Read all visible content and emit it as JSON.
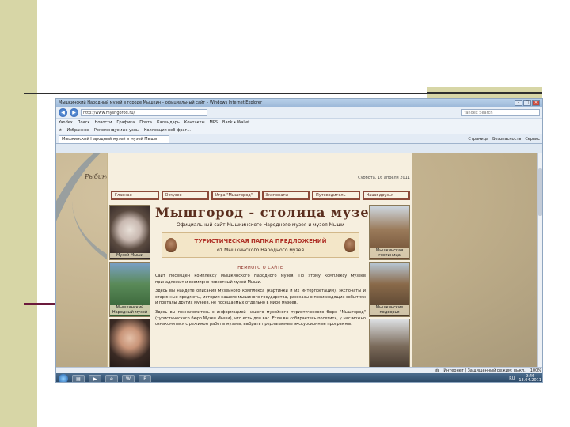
{
  "browser": {
    "title": "Мышкинский Народный музей в городе Мышкин – официальный сайт – Windows Internet Explorer",
    "url": "http://www.myshgorod.ru/",
    "search_placeholder": "Yandex Search",
    "links": [
      "Yandex",
      "Поиск",
      "Новости",
      "Графика",
      "Почта",
      "Календарь",
      "Контакты",
      "MPS",
      "Bank • Wallet"
    ],
    "favorites_label": "Избранное",
    "favorites": [
      "Рекомендуемые узлы",
      "Коллекция веб-фраг..."
    ],
    "tab_label": "Мышкинский Народный музей и музей Мыши",
    "commands": [
      "Страница",
      "Безопасность",
      "Сервис"
    ],
    "status_text": "Интернет | Защищенный режим: выкл.",
    "zoom": "100%"
  },
  "page": {
    "map_label": "Рыбинск",
    "date": "Суббота, 16 апреля 2011",
    "menu": [
      "Главная",
      "О музее",
      "Игра \"Мышгород\"",
      "Экспонаты",
      "Путеводитель",
      "Наши друзья"
    ],
    "title": "Мышгород - столица музеев",
    "subtitle": "Официальный сайт Мышкинского Народного музея и музея Мыши",
    "banner_title": "ТУРИСТИЧЕСКАЯ ПАПКА ПРЕДЛОЖЕНИЙ",
    "banner_sub": "от Мышкинского Народного музея",
    "section_head": "НЕМНОГО О САЙТЕ",
    "paragraphs": [
      "Сайт посвящен комплексу Мышкинского Народного музея. По этому комплексу музеев принадлежит и всемирно известный музей Мыши.",
      "Здесь вы найдете описания музейного комплекса (картинки и их интерпретации), экспонаты и старинные предметы, история нашего мышиного государства, рассказы о происходящих событиях и порталы других музеев, не посещаемых отдельно в мире музеев.",
      "Здесь вы познакомитесь с информацией нашего музейного туристического бюро \"Мышгород\" (туристического бюро Музея Мыши), что есть для вас. Если вы собираетесь посетить, у нас можно ознакомиться с режимом работы музеев, выбрать предлагаемые экскурсионные программы,"
    ],
    "photos_left": [
      {
        "caption": "Музей Мыши"
      },
      {
        "caption": "Мышкинский Народный музей"
      },
      {
        "caption": ""
      }
    ],
    "photos_right": [
      {
        "caption": "Мышкинская гостиница"
      },
      {
        "caption": "Мышкинские подворья"
      },
      {
        "caption": ""
      }
    ]
  },
  "taskbar": {
    "lang": "RU",
    "time": "9:46",
    "date": "13.04.2011"
  }
}
